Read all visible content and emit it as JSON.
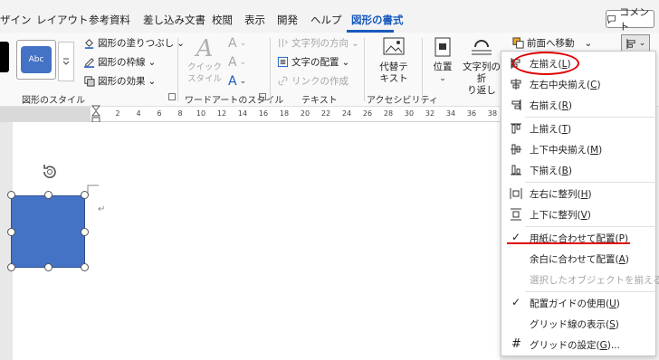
{
  "tabs": [
    "ザイン",
    "レイアウト",
    "参考資料",
    "差し込み文書",
    "校閲",
    "表示",
    "開発",
    "ヘルプ",
    "図形の書式"
  ],
  "active_tab": "図形の書式",
  "comment_button": "コメント",
  "ribbon": {
    "shape_styles": {
      "sample_label": "Abc",
      "fill": "図形の塗りつぶし",
      "outline": "図形の枠線",
      "effects": "図形の効果",
      "group_label": "図形のスタイル"
    },
    "wordart": {
      "quick_style": "クイック\nスタイル",
      "group_label": "ワードアートのスタイル"
    },
    "text": {
      "direction": "文字列の方向",
      "align": "文字の配置",
      "link": "リンクの作成",
      "group_label": "テキスト"
    },
    "accessibility": {
      "alt_text": "代替テ\nキスト",
      "group_label": "アクセシビリティ"
    },
    "arrange": {
      "position": "位置",
      "wrap": "文字列の折\nり返し",
      "bring_forward": "前面へ移動"
    }
  },
  "ruler_ticks": [
    "2",
    "4",
    "6",
    "8",
    "10",
    "12",
    "14",
    "16",
    "18",
    "20",
    "22",
    "24",
    "26",
    "28",
    "30",
    "32",
    "34",
    "36",
    "38"
  ],
  "menu": {
    "items": [
      {
        "label": "左揃え(",
        "key": "L",
        "tail": ")",
        "icon": "align-left-icon"
      },
      {
        "label": "左右中央揃え(",
        "key": "C",
        "tail": ")",
        "icon": "align-center-icon"
      },
      {
        "label": "右揃え(",
        "key": "R",
        "tail": ")",
        "icon": "align-right-icon"
      },
      {
        "label": "上揃え(",
        "key": "T",
        "tail": ")",
        "icon": "align-top-icon"
      },
      {
        "label": "上下中央揃え(",
        "key": "M",
        "tail": ")",
        "icon": "align-middle-icon"
      },
      {
        "label": "下揃え(",
        "key": "B",
        "tail": ")",
        "icon": "align-bottom-icon"
      },
      {
        "label": "左右に整列(",
        "key": "H",
        "tail": ")",
        "icon": "distribute-horizontal-icon"
      },
      {
        "label": "上下に整列(",
        "key": "V",
        "tail": ")",
        "icon": "distribute-vertical-icon"
      },
      {
        "label": "用紙に合わせて配置(",
        "key": "P",
        "tail": ")",
        "icon": "check-icon"
      },
      {
        "label": "余白に合わせて配置(",
        "key": "A",
        "tail": ")",
        "icon": ""
      },
      {
        "label": "選択したオブジェクトを揃える(",
        "key": "O",
        "tail": ")",
        "icon": ""
      },
      {
        "label": "配置ガイドの使用(",
        "key": "U",
        "tail": ")",
        "icon": "check-icon"
      },
      {
        "label": "グリッド線の表示(",
        "key": "S",
        "tail": ")",
        "icon": ""
      },
      {
        "label": "グリッドの設定(",
        "key": "G",
        "tail": ")...",
        "icon": "grid-icon"
      }
    ]
  },
  "colors": {
    "accent": "#185abd",
    "shape_fill": "#4472c4",
    "annotation": "#e00000"
  }
}
